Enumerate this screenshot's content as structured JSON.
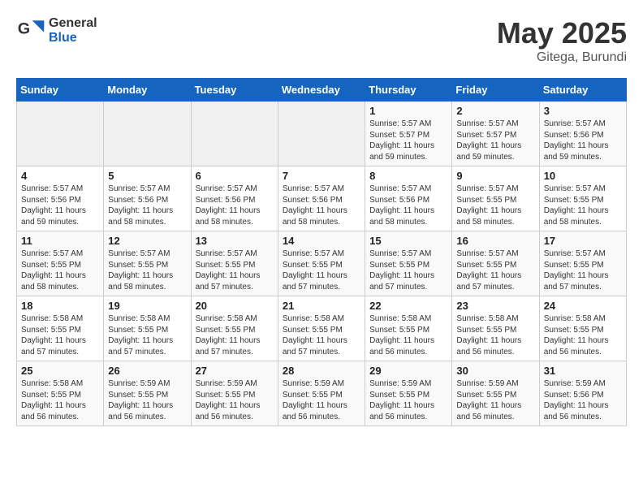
{
  "header": {
    "logo_general": "General",
    "logo_blue": "Blue",
    "month_year": "May 2025",
    "location": "Gitega, Burundi"
  },
  "weekdays": [
    "Sunday",
    "Monday",
    "Tuesday",
    "Wednesday",
    "Thursday",
    "Friday",
    "Saturday"
  ],
  "weeks": [
    [
      {
        "day": "",
        "info": ""
      },
      {
        "day": "",
        "info": ""
      },
      {
        "day": "",
        "info": ""
      },
      {
        "day": "",
        "info": ""
      },
      {
        "day": "1",
        "info": "Sunrise: 5:57 AM\nSunset: 5:57 PM\nDaylight: 11 hours\nand 59 minutes."
      },
      {
        "day": "2",
        "info": "Sunrise: 5:57 AM\nSunset: 5:57 PM\nDaylight: 11 hours\nand 59 minutes."
      },
      {
        "day": "3",
        "info": "Sunrise: 5:57 AM\nSunset: 5:56 PM\nDaylight: 11 hours\nand 59 minutes."
      }
    ],
    [
      {
        "day": "4",
        "info": "Sunrise: 5:57 AM\nSunset: 5:56 PM\nDaylight: 11 hours\nand 59 minutes."
      },
      {
        "day": "5",
        "info": "Sunrise: 5:57 AM\nSunset: 5:56 PM\nDaylight: 11 hours\nand 58 minutes."
      },
      {
        "day": "6",
        "info": "Sunrise: 5:57 AM\nSunset: 5:56 PM\nDaylight: 11 hours\nand 58 minutes."
      },
      {
        "day": "7",
        "info": "Sunrise: 5:57 AM\nSunset: 5:56 PM\nDaylight: 11 hours\nand 58 minutes."
      },
      {
        "day": "8",
        "info": "Sunrise: 5:57 AM\nSunset: 5:56 PM\nDaylight: 11 hours\nand 58 minutes."
      },
      {
        "day": "9",
        "info": "Sunrise: 5:57 AM\nSunset: 5:55 PM\nDaylight: 11 hours\nand 58 minutes."
      },
      {
        "day": "10",
        "info": "Sunrise: 5:57 AM\nSunset: 5:55 PM\nDaylight: 11 hours\nand 58 minutes."
      }
    ],
    [
      {
        "day": "11",
        "info": "Sunrise: 5:57 AM\nSunset: 5:55 PM\nDaylight: 11 hours\nand 58 minutes."
      },
      {
        "day": "12",
        "info": "Sunrise: 5:57 AM\nSunset: 5:55 PM\nDaylight: 11 hours\nand 58 minutes."
      },
      {
        "day": "13",
        "info": "Sunrise: 5:57 AM\nSunset: 5:55 PM\nDaylight: 11 hours\nand 57 minutes."
      },
      {
        "day": "14",
        "info": "Sunrise: 5:57 AM\nSunset: 5:55 PM\nDaylight: 11 hours\nand 57 minutes."
      },
      {
        "day": "15",
        "info": "Sunrise: 5:57 AM\nSunset: 5:55 PM\nDaylight: 11 hours\nand 57 minutes."
      },
      {
        "day": "16",
        "info": "Sunrise: 5:57 AM\nSunset: 5:55 PM\nDaylight: 11 hours\nand 57 minutes."
      },
      {
        "day": "17",
        "info": "Sunrise: 5:57 AM\nSunset: 5:55 PM\nDaylight: 11 hours\nand 57 minutes."
      }
    ],
    [
      {
        "day": "18",
        "info": "Sunrise: 5:58 AM\nSunset: 5:55 PM\nDaylight: 11 hours\nand 57 minutes."
      },
      {
        "day": "19",
        "info": "Sunrise: 5:58 AM\nSunset: 5:55 PM\nDaylight: 11 hours\nand 57 minutes."
      },
      {
        "day": "20",
        "info": "Sunrise: 5:58 AM\nSunset: 5:55 PM\nDaylight: 11 hours\nand 57 minutes."
      },
      {
        "day": "21",
        "info": "Sunrise: 5:58 AM\nSunset: 5:55 PM\nDaylight: 11 hours\nand 57 minutes."
      },
      {
        "day": "22",
        "info": "Sunrise: 5:58 AM\nSunset: 5:55 PM\nDaylight: 11 hours\nand 56 minutes."
      },
      {
        "day": "23",
        "info": "Sunrise: 5:58 AM\nSunset: 5:55 PM\nDaylight: 11 hours\nand 56 minutes."
      },
      {
        "day": "24",
        "info": "Sunrise: 5:58 AM\nSunset: 5:55 PM\nDaylight: 11 hours\nand 56 minutes."
      }
    ],
    [
      {
        "day": "25",
        "info": "Sunrise: 5:58 AM\nSunset: 5:55 PM\nDaylight: 11 hours\nand 56 minutes."
      },
      {
        "day": "26",
        "info": "Sunrise: 5:59 AM\nSunset: 5:55 PM\nDaylight: 11 hours\nand 56 minutes."
      },
      {
        "day": "27",
        "info": "Sunrise: 5:59 AM\nSunset: 5:55 PM\nDaylight: 11 hours\nand 56 minutes."
      },
      {
        "day": "28",
        "info": "Sunrise: 5:59 AM\nSunset: 5:55 PM\nDaylight: 11 hours\nand 56 minutes."
      },
      {
        "day": "29",
        "info": "Sunrise: 5:59 AM\nSunset: 5:55 PM\nDaylight: 11 hours\nand 56 minutes."
      },
      {
        "day": "30",
        "info": "Sunrise: 5:59 AM\nSunset: 5:55 PM\nDaylight: 11 hours\nand 56 minutes."
      },
      {
        "day": "31",
        "info": "Sunrise: 5:59 AM\nSunset: 5:56 PM\nDaylight: 11 hours\nand 56 minutes."
      }
    ]
  ]
}
